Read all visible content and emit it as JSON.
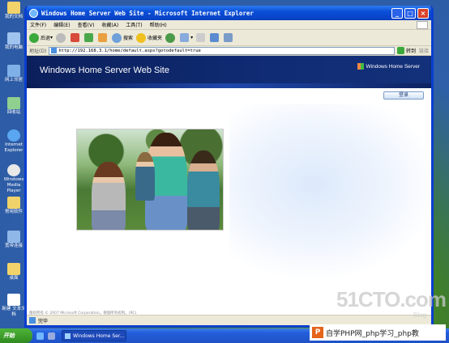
{
  "desktop": {
    "icons": [
      "我的文档",
      "我的电脑",
      "网上邻居",
      "回收站",
      "Internet Explorer",
      "Windows Media Player",
      "常用软件",
      "宽带连接",
      "桌面",
      "新建 文本文档"
    ]
  },
  "window": {
    "title": "Windows Home Server Web Site - Microsoft Internet Explorer",
    "menu": [
      "文件(F)",
      "编辑(E)",
      "查看(V)",
      "收藏(A)",
      "工具(T)",
      "帮助(H)"
    ],
    "toolbar": {
      "back": "后退",
      "search": "搜索",
      "favorites": "收藏夹"
    },
    "address": {
      "label": "地址(D)",
      "url": "http://192.168.3.1/home/default.aspx?gotodefault=true",
      "go": "转到",
      "links": "链接"
    }
  },
  "page": {
    "site_title": "Windows Home Server Web Site",
    "brand": "Windows Home Server",
    "login_button": "登录",
    "footer": "版权所有 © 2007 Microsoft Corporation。保留所有权利。(RC)"
  },
  "statusbar": {
    "text": "完毕"
  },
  "taskbar": {
    "start": "开始",
    "task_item": "Windows Home Ser..."
  },
  "watermarks": {
    "site": "51CTO.com",
    "blog": "Blog",
    "php": "自学PHP网_php学习_php教"
  },
  "colors": {
    "banner": "#0b1f5c",
    "titlebar": "#0a4fd8",
    "taskbar": "#245edb",
    "start": "#2f8a1f"
  }
}
